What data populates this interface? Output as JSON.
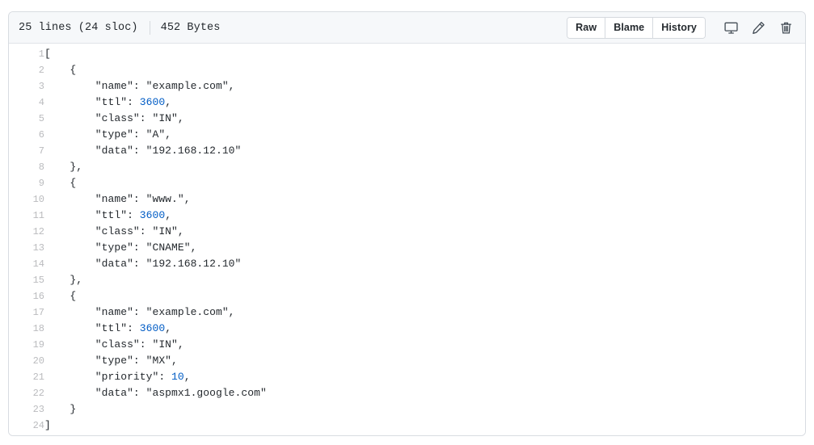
{
  "header": {
    "lines_text": "25 lines (24 sloc)",
    "size_text": "452 Bytes",
    "buttons": [
      {
        "label": "Raw",
        "name": "raw-button"
      },
      {
        "label": "Blame",
        "name": "blame-button"
      },
      {
        "label": "History",
        "name": "history-button"
      }
    ],
    "icons": [
      {
        "name": "desktop-icon",
        "title": "Open in desktop"
      },
      {
        "name": "pencil-icon",
        "title": "Edit this file"
      },
      {
        "name": "trash-icon",
        "title": "Delete this file"
      }
    ]
  },
  "colors": {
    "header_bg": "#f6f8fa",
    "border": "#d8dce1",
    "text": "#24292e",
    "line_number": "#babbbe",
    "number_token": "#005cc5"
  },
  "code": {
    "language": "json",
    "total_lines": 24,
    "lines": [
      {
        "n": "1",
        "tokens": [
          {
            "t": "[",
            "c": "punc"
          }
        ]
      },
      {
        "n": "2",
        "tokens": [
          {
            "t": "    {",
            "c": "punc"
          }
        ]
      },
      {
        "n": "3",
        "tokens": [
          {
            "t": "        \"name\": \"example.com\",",
            "c": "str"
          }
        ]
      },
      {
        "n": "4",
        "tokens": [
          {
            "t": "        \"ttl\": ",
            "c": "key"
          },
          {
            "t": "3600",
            "c": "num"
          },
          {
            "t": ",",
            "c": "punc"
          }
        ]
      },
      {
        "n": "5",
        "tokens": [
          {
            "t": "        \"class\": \"IN\",",
            "c": "str"
          }
        ]
      },
      {
        "n": "6",
        "tokens": [
          {
            "t": "        \"type\": \"A\",",
            "c": "str"
          }
        ]
      },
      {
        "n": "7",
        "tokens": [
          {
            "t": "        \"data\": \"192.168.12.10\"",
            "c": "str"
          }
        ]
      },
      {
        "n": "8",
        "tokens": [
          {
            "t": "    },",
            "c": "punc"
          }
        ]
      },
      {
        "n": "9",
        "tokens": [
          {
            "t": "    {",
            "c": "punc"
          }
        ]
      },
      {
        "n": "10",
        "tokens": [
          {
            "t": "        \"name\": \"www.\",",
            "c": "str"
          }
        ]
      },
      {
        "n": "11",
        "tokens": [
          {
            "t": "        \"ttl\": ",
            "c": "key"
          },
          {
            "t": "3600",
            "c": "num"
          },
          {
            "t": ",",
            "c": "punc"
          }
        ]
      },
      {
        "n": "12",
        "tokens": [
          {
            "t": "        \"class\": \"IN\",",
            "c": "str"
          }
        ]
      },
      {
        "n": "13",
        "tokens": [
          {
            "t": "        \"type\": \"CNAME\",",
            "c": "str"
          }
        ]
      },
      {
        "n": "14",
        "tokens": [
          {
            "t": "        \"data\": \"192.168.12.10\"",
            "c": "str"
          }
        ]
      },
      {
        "n": "15",
        "tokens": [
          {
            "t": "    },",
            "c": "punc"
          }
        ]
      },
      {
        "n": "16",
        "tokens": [
          {
            "t": "    {",
            "c": "punc"
          }
        ]
      },
      {
        "n": "17",
        "tokens": [
          {
            "t": "        \"name\": \"example.com\",",
            "c": "str"
          }
        ]
      },
      {
        "n": "18",
        "tokens": [
          {
            "t": "        \"ttl\": ",
            "c": "key"
          },
          {
            "t": "3600",
            "c": "num"
          },
          {
            "t": ",",
            "c": "punc"
          }
        ]
      },
      {
        "n": "19",
        "tokens": [
          {
            "t": "        \"class\": \"IN\",",
            "c": "str"
          }
        ]
      },
      {
        "n": "20",
        "tokens": [
          {
            "t": "        \"type\": \"MX\",",
            "c": "str"
          }
        ]
      },
      {
        "n": "21",
        "tokens": [
          {
            "t": "        \"priority\": ",
            "c": "key"
          },
          {
            "t": "10",
            "c": "num"
          },
          {
            "t": ",",
            "c": "punc"
          }
        ]
      },
      {
        "n": "22",
        "tokens": [
          {
            "t": "        \"data\": \"aspmx1.google.com\"",
            "c": "str"
          }
        ]
      },
      {
        "n": "23",
        "tokens": [
          {
            "t": "    }",
            "c": "punc"
          }
        ]
      },
      {
        "n": "24",
        "tokens": [
          {
            "t": "]",
            "c": "punc"
          }
        ]
      }
    ]
  }
}
